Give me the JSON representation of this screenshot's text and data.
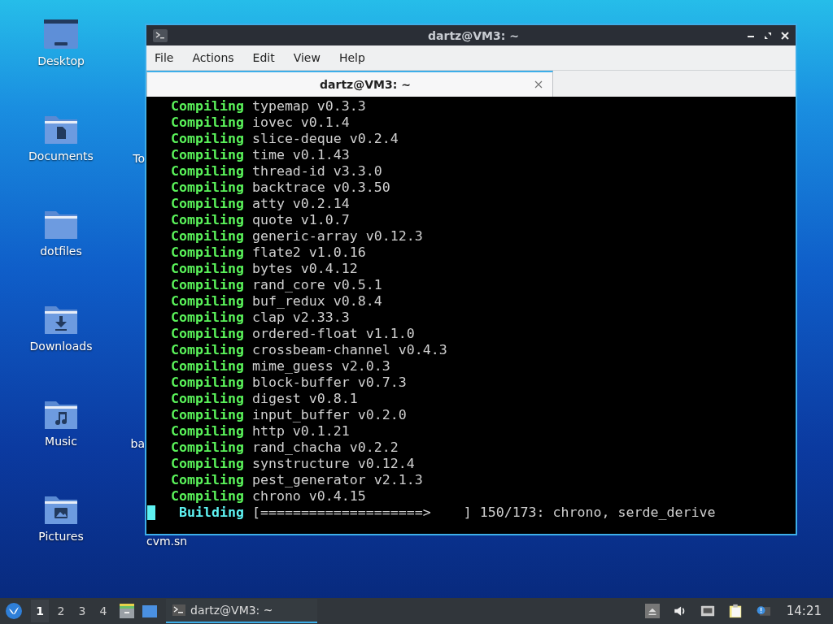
{
  "desktop_icons": [
    {
      "label": "Desktop",
      "kind": "desktop"
    },
    {
      "label": "Documents",
      "kind": "document"
    },
    {
      "label": "dotfiles",
      "kind": "folder"
    },
    {
      "label": "Downloads",
      "kind": "download"
    },
    {
      "label": "Music",
      "kind": "music"
    },
    {
      "label": "Pictures",
      "kind": "pictures"
    }
  ],
  "desktop_icons_column_2": [
    {
      "label": "To"
    },
    {
      "label": "ba"
    },
    {
      "label": "cvm.sn"
    }
  ],
  "window": {
    "title": "dartz@VM3: ~",
    "menu": [
      "File",
      "Actions",
      "Edit",
      "View",
      "Help"
    ],
    "tabs": [
      {
        "label": "dartz@VM3: ~",
        "selected": true
      }
    ],
    "lines": [
      {
        "kind": "compiling",
        "verb": "Compiling",
        "text": "typemap v0.3.3"
      },
      {
        "kind": "compiling",
        "verb": "Compiling",
        "text": "iovec v0.1.4"
      },
      {
        "kind": "compiling",
        "verb": "Compiling",
        "text": "slice-deque v0.2.4"
      },
      {
        "kind": "compiling",
        "verb": "Compiling",
        "text": "time v0.1.43"
      },
      {
        "kind": "compiling",
        "verb": "Compiling",
        "text": "thread-id v3.3.0"
      },
      {
        "kind": "compiling",
        "verb": "Compiling",
        "text": "backtrace v0.3.50"
      },
      {
        "kind": "compiling",
        "verb": "Compiling",
        "text": "atty v0.2.14"
      },
      {
        "kind": "compiling",
        "verb": "Compiling",
        "text": "quote v1.0.7"
      },
      {
        "kind": "compiling",
        "verb": "Compiling",
        "text": "generic-array v0.12.3"
      },
      {
        "kind": "compiling",
        "verb": "Compiling",
        "text": "flate2 v1.0.16"
      },
      {
        "kind": "compiling",
        "verb": "Compiling",
        "text": "bytes v0.4.12"
      },
      {
        "kind": "compiling",
        "verb": "Compiling",
        "text": "rand_core v0.5.1"
      },
      {
        "kind": "compiling",
        "verb": "Compiling",
        "text": "buf_redux v0.8.4"
      },
      {
        "kind": "compiling",
        "verb": "Compiling",
        "text": "clap v2.33.3"
      },
      {
        "kind": "compiling",
        "verb": "Compiling",
        "text": "ordered-float v1.1.0"
      },
      {
        "kind": "compiling",
        "verb": "Compiling",
        "text": "crossbeam-channel v0.4.3"
      },
      {
        "kind": "compiling",
        "verb": "Compiling",
        "text": "mime_guess v2.0.3"
      },
      {
        "kind": "compiling",
        "verb": "Compiling",
        "text": "block-buffer v0.7.3"
      },
      {
        "kind": "compiling",
        "verb": "Compiling",
        "text": "digest v0.8.1"
      },
      {
        "kind": "compiling",
        "verb": "Compiling",
        "text": "input_buffer v0.2.0"
      },
      {
        "kind": "compiling",
        "verb": "Compiling",
        "text": "http v0.1.21"
      },
      {
        "kind": "compiling",
        "verb": "Compiling",
        "text": "rand_chacha v0.2.2"
      },
      {
        "kind": "compiling",
        "verb": "Compiling",
        "text": "synstructure v0.12.4"
      },
      {
        "kind": "compiling",
        "verb": "Compiling",
        "text": "pest_generator v2.1.3"
      },
      {
        "kind": "compiling",
        "verb": "Compiling",
        "text": "chrono v0.4.15"
      },
      {
        "kind": "building",
        "verb": "Building",
        "text": "[====================>    ] 150/173: chrono, serde_derive"
      }
    ]
  },
  "taskbar": {
    "workspaces": [
      {
        "label": "1",
        "selected": true
      },
      {
        "label": "2",
        "selected": false
      },
      {
        "label": "3",
        "selected": false
      },
      {
        "label": "4",
        "selected": false
      }
    ],
    "tasks": [
      {
        "label": "dartz@VM3: ~",
        "selected": true
      }
    ],
    "clock": "14:21"
  }
}
